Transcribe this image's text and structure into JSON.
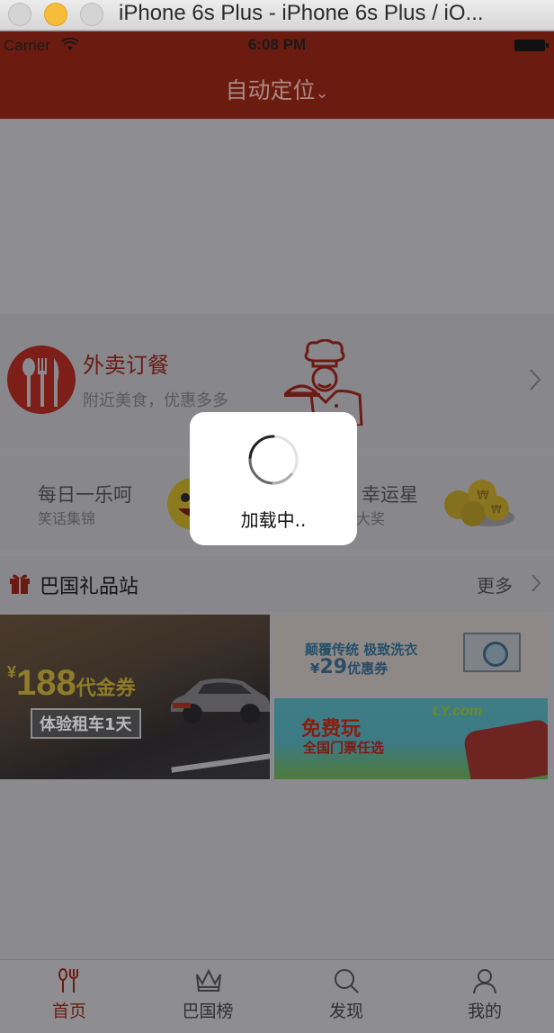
{
  "window": {
    "title": "iPhone 6s Plus - iPhone 6s Plus / iO..."
  },
  "status_bar": {
    "carrier": "Carrier",
    "time": "6:08 PM"
  },
  "nav": {
    "title": "自动定位",
    "chevron": "⌄"
  },
  "takeout": {
    "title": "外卖订餐",
    "subtitle": "附近美食，优惠多多"
  },
  "promos": {
    "left": {
      "title": "每日一乐呵",
      "subtitle": "笑话集锦"
    },
    "right": {
      "title": "幸运星",
      "subtitle": "大奖"
    }
  },
  "gift_section": {
    "title": "巴国礼品站",
    "more": "更多"
  },
  "tiles": {
    "car": {
      "yen": "¥",
      "price": "188",
      "unit": "代金券",
      "badge": "体验租车1天"
    },
    "wash": {
      "line1": "颠覆传统 极致洗衣",
      "yen": "¥",
      "price": "29",
      "unit": "优惠券"
    },
    "ticket": {
      "title": "免费玩",
      "subtitle": "全国门票任选",
      "logo": "LY.com"
    }
  },
  "tabbar": {
    "items": [
      {
        "label": "首页",
        "icon": "food-icon",
        "active": true
      },
      {
        "label": "巴国榜",
        "icon": "crown-icon",
        "active": false
      },
      {
        "label": "发现",
        "icon": "search-icon",
        "active": false
      },
      {
        "label": "我的",
        "icon": "person-icon",
        "active": false
      }
    ]
  },
  "hud": {
    "text": "加载中.."
  },
  "colors": {
    "brand": "#6c1b10",
    "overlay": "#8a8a8f",
    "hud_bg": "#ffffff"
  }
}
